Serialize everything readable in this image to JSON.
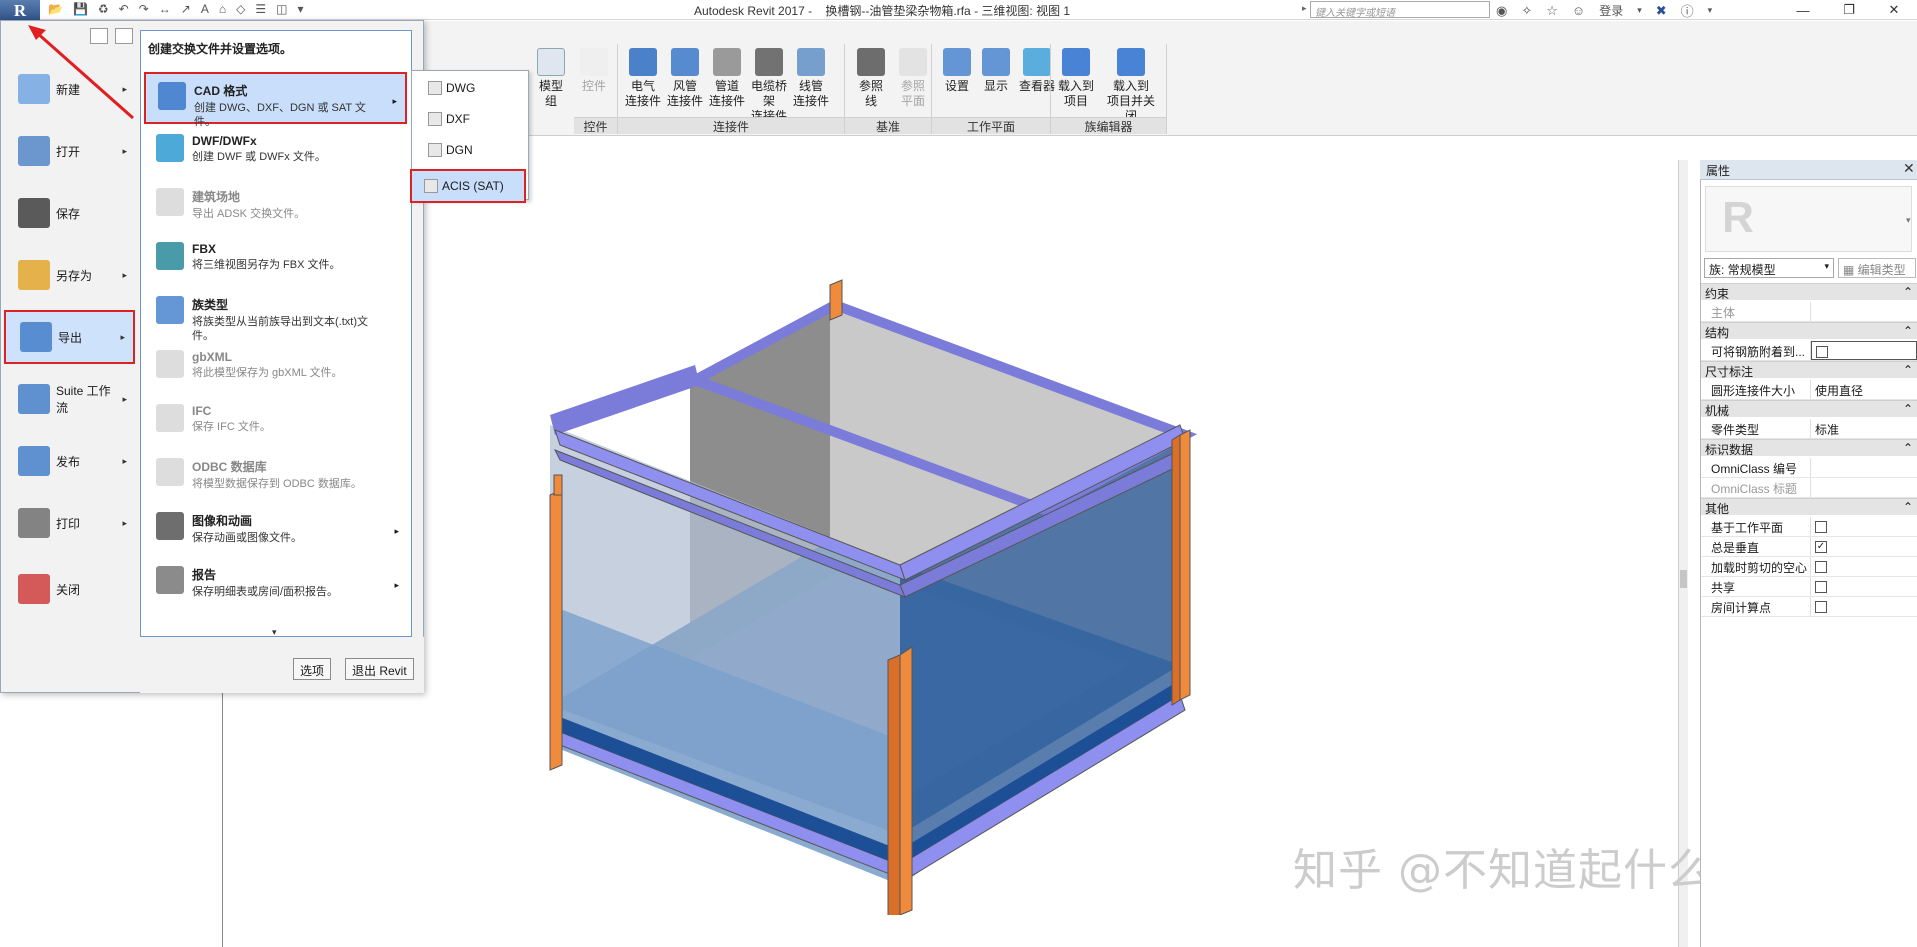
{
  "titlebar": {
    "app_letter": "R",
    "title": "Autodesk Revit 2017 -    换槽钢--油管垫梁杂物箱.rfa - 三维视图: 视图 1",
    "search_placeholder": "键入关键字或短语",
    "login": "登录",
    "icons": [
      "binoculars-icon",
      "satellite-icon",
      "star-icon",
      "user-icon",
      "exchange-icon",
      "help-icon"
    ]
  },
  "ribbon": {
    "partial_labels": {
      "model_line": "模型\n组",
      "control": "控件"
    },
    "buttons": [
      {
        "label": "电气\n连接件",
        "icon": "electrical-connector-icon",
        "enabled": true
      },
      {
        "label": "风管\n连接件",
        "icon": "duct-connector-icon",
        "enabled": true
      },
      {
        "label": "管道\n连接件",
        "icon": "pipe-connector-icon",
        "enabled": true
      },
      {
        "label": "电缆桥架\n连接件",
        "icon": "cable-tray-connector-icon",
        "enabled": true
      },
      {
        "label": "线管\n连接件",
        "icon": "conduit-connector-icon",
        "enabled": true
      },
      {
        "label": "参照\n线",
        "icon": "reference-line-icon",
        "enabled": true
      },
      {
        "label": "参照\n平面",
        "icon": "reference-plane-icon",
        "enabled": false
      },
      {
        "label": "设置",
        "icon": "set-workplane-icon",
        "enabled": true
      },
      {
        "label": "显示",
        "icon": "show-workplane-icon",
        "enabled": true
      },
      {
        "label": "查看器",
        "icon": "viewer-icon",
        "enabled": true
      },
      {
        "label": "载入到\n项目",
        "icon": "load-into-project-icon",
        "enabled": true
      },
      {
        "label": "载入到\n项目并关闭",
        "icon": "load-and-close-icon",
        "enabled": true
      }
    ],
    "groups": [
      "控件",
      "连接件",
      "基准",
      "工作平面",
      "族编辑器"
    ]
  },
  "app_menu": {
    "left_items": [
      {
        "label": "新建",
        "icon": "new-icon"
      },
      {
        "label": "打开",
        "icon": "open-folder-icon"
      },
      {
        "label": "保存",
        "icon": "save-icon"
      },
      {
        "label": "另存为",
        "icon": "save-as-icon"
      },
      {
        "label": "导出",
        "icon": "export-icon"
      },
      {
        "label": "Suite 工作流",
        "icon": "suite-workflow-icon"
      },
      {
        "label": "发布",
        "icon": "publish-icon"
      },
      {
        "label": "打印",
        "icon": "print-icon"
      },
      {
        "label": "关闭",
        "icon": "close-file-icon"
      }
    ],
    "submenu_header": "创建交换文件并设置选项。",
    "submenu_items": [
      {
        "title": "CAD 格式",
        "desc": "创建 DWG、DXF、DGN 或 SAT 文件。",
        "icon": "cad-format-icon",
        "arrow": true,
        "highlighted": true
      },
      {
        "title": "DWF/DWFx",
        "desc": "创建 DWF 或 DWFx 文件。",
        "icon": "dwf-icon",
        "arrow": false
      },
      {
        "title": "建筑场地",
        "desc": "导出 ADSK 交换文件。",
        "icon": "building-site-icon",
        "arrow": false,
        "disabled": true
      },
      {
        "title": "FBX",
        "desc": "将三维视图另存为 FBX 文件。",
        "icon": "fbx-icon",
        "arrow": false
      },
      {
        "title": "族类型",
        "desc": "将族类型从当前族导出到文本(.txt)文件。",
        "icon": "family-types-icon",
        "arrow": false
      },
      {
        "title": "gbXML",
        "desc": "将此模型保存为 gbXML 文件。",
        "icon": "gbxml-icon",
        "arrow": false,
        "disabled": true
      },
      {
        "title": "IFC",
        "desc": "保存 IFC 文件。",
        "icon": "ifc-icon",
        "arrow": false,
        "disabled": true
      },
      {
        "title": "ODBC 数据库",
        "desc": "将模型数据保存到 ODBC 数据库。",
        "icon": "odbc-icon",
        "arrow": false,
        "disabled": true
      },
      {
        "title": "图像和动画",
        "desc": "保存动画或图像文件。",
        "icon": "image-animation-icon",
        "arrow": true
      },
      {
        "title": "报告",
        "desc": "保存明细表或房间/面积报告。",
        "icon": "report-icon",
        "arrow": true
      }
    ],
    "flyout": [
      "DWG",
      "DXF",
      "DGN",
      "ACIS (SAT)"
    ],
    "options_button": "选项",
    "exit_button": "退出 Revit"
  },
  "properties": {
    "title": "属性",
    "logo_letter": "R",
    "type_selector": "族: 常规模型",
    "edit_type": "编辑类型",
    "sections": [
      {
        "name": "约束",
        "rows": [
          {
            "k": "主体",
            "v": "",
            "dim": true
          }
        ]
      },
      {
        "name": "结构",
        "rows": [
          {
            "k": "可将钢筋附着到...",
            "v": "",
            "checkbox": false,
            "boxed": true
          }
        ]
      },
      {
        "name": "尺寸标注",
        "rows": [
          {
            "k": "圆形连接件大小",
            "v": "使用直径"
          }
        ]
      },
      {
        "name": "机械",
        "rows": [
          {
            "k": "零件类型",
            "v": "标准"
          }
        ]
      },
      {
        "name": "标识数据",
        "rows": [
          {
            "k": "OmniClass 编号",
            "v": ""
          },
          {
            "k": "OmniClass 标题",
            "v": "",
            "dim": true
          }
        ]
      },
      {
        "name": "其他",
        "rows": [
          {
            "k": "基于工作平面",
            "v": "",
            "checkbox": false
          },
          {
            "k": "总是垂直",
            "v": "",
            "checkbox": true
          },
          {
            "k": "加载时剪切的空心",
            "v": "",
            "checkbox": false
          },
          {
            "k": "共享",
            "v": "",
            "checkbox": false
          },
          {
            "k": "房间计算点",
            "v": "",
            "checkbox": false
          }
        ]
      }
    ]
  },
  "watermark": "知乎 @不知道起什么名",
  "colors": {
    "accent_red": "#dd2222",
    "highlight": "#c9defa",
    "frame": "#7b7bd9",
    "post": "#f08a3c",
    "panel_blue": "#1f5fa8"
  }
}
